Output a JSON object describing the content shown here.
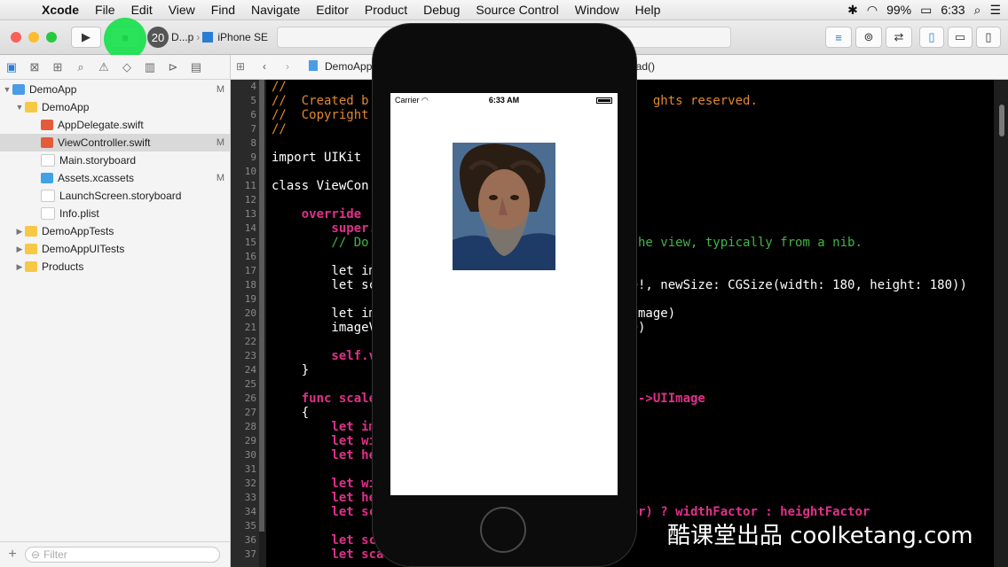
{
  "menubar": {
    "items": [
      "Xcode",
      "File",
      "Edit",
      "View",
      "Find",
      "Navigate",
      "Editor",
      "Product",
      "Debug",
      "Source Control",
      "Window",
      "Help"
    ],
    "battery": "99%",
    "clock": "6:33"
  },
  "toolbar": {
    "badge": "20",
    "scheme": "D...p",
    "device": "iPhone SE"
  },
  "navigator": {
    "items": [
      {
        "label": "DemoApp",
        "status": "M"
      },
      {
        "label": "DemoApp",
        "status": ""
      },
      {
        "label": "AppDelegate.swift",
        "status": ""
      },
      {
        "label": "ViewController.swift",
        "status": "M"
      },
      {
        "label": "Main.storyboard",
        "status": ""
      },
      {
        "label": "Assets.xcassets",
        "status": "M"
      },
      {
        "label": "LaunchScreen.storyboard",
        "status": ""
      },
      {
        "label": "Info.plist",
        "status": ""
      },
      {
        "label": "DemoAppTests",
        "status": ""
      },
      {
        "label": "DemoAppUITests",
        "status": ""
      },
      {
        "label": "Products",
        "status": ""
      }
    ],
    "filter_placeholder": "Filter"
  },
  "jumpbar": {
    "project": "DemoApp",
    "method": "oad()"
  },
  "editor": {
    "line_numbers": [
      "4",
      "5",
      "6",
      "7",
      "8",
      "9",
      "10",
      "11",
      "12",
      "13",
      "14",
      "15",
      "16",
      "17",
      "18",
      "19",
      "20",
      "21",
      "22",
      "23",
      "24",
      "25",
      "26",
      "27",
      "28",
      "29",
      "30",
      "31",
      "32",
      "33",
      "34",
      "35",
      "36",
      "37"
    ],
    "lines": [
      "//",
      "//  Created b                                      ghts reserved.",
      "//  Copyright",
      "//",
      "",
      "import UIKit",
      "",
      "class ViewCon",
      "",
      "    override",
      "        super.",
      "        // Do                                   the view, typically from a nib.",
      "",
      "        let im",
      "        let sc                                  e!, newSize: CGSize(width: 180, height: 180))",
      "",
      "        let im                                  Image)",
      "        imageV                                  0)",
      "",
      "        self.v",
      "    }",
      "",
      "    func scale                                  )->UIImage",
      "    {",
      "        let im",
      "        let wi",
      "        let he",
      "",
      "        let wi",
      "        let he",
      "        let sc                                  or) ? widthFactor : heightFactor",
      "",
      "        let sca",
      "        let scale"
    ]
  },
  "simulator": {
    "carrier": "Carrier",
    "time": "6:33 AM"
  },
  "watermark": "酷课堂出品 coolketang.com"
}
